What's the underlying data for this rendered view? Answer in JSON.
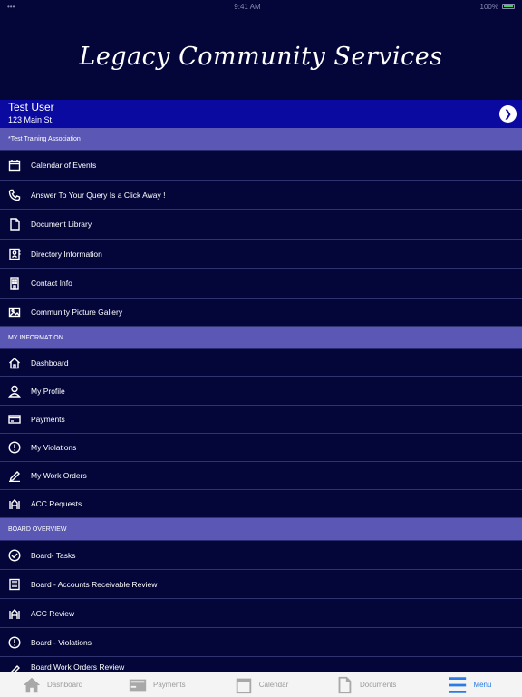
{
  "status_bar": {
    "time": "9:41 AM",
    "battery": "100%"
  },
  "brand": {
    "title": "Legacy Community Services"
  },
  "user": {
    "name": "Test User",
    "address": "123 Main St.",
    "go_icon": "chevron-right-icon"
  },
  "menu": {
    "association_header": "*Test Training Association",
    "association_items": [
      {
        "label": "Calendar of Events",
        "icon": "calendar-icon"
      },
      {
        "label": "Answer To Your Query Is a Click Away !",
        "icon": "phone-icon"
      },
      {
        "label": "Document Library",
        "icon": "document-icon"
      },
      {
        "label": "Directory Information",
        "icon": "contact-card-icon"
      },
      {
        "label": "Contact Info",
        "icon": "building-icon"
      },
      {
        "label": "Community Picture Gallery",
        "icon": "image-icon"
      }
    ],
    "my_info_header": "MY INFORMATION",
    "my_info_items": [
      {
        "label": "Dashboard",
        "icon": "home-icon"
      },
      {
        "label": "My Profile",
        "icon": "person-icon"
      },
      {
        "label": "Payments",
        "icon": "card-icon"
      },
      {
        "label": "My Violations",
        "icon": "alert-icon"
      },
      {
        "label": "My Work Orders",
        "icon": "pen-icon"
      },
      {
        "label": "ACC Requests",
        "icon": "acc-icon"
      }
    ],
    "board_header": "BOARD OVERVIEW",
    "board_items": [
      {
        "label": "Board- Tasks",
        "icon": "check-circle-icon"
      },
      {
        "label": "Board - Accounts Receivable Review",
        "icon": "ledger-icon"
      },
      {
        "label": "ACC Review",
        "icon": "acc-icon"
      },
      {
        "label": "Board - Violations",
        "icon": "alert-icon"
      },
      {
        "label": "Board Work Orders Review",
        "icon": "pen-icon"
      }
    ]
  },
  "tabs": [
    {
      "label": "Dashboard",
      "icon": "home-icon"
    },
    {
      "label": "Payments",
      "icon": "card-icon"
    },
    {
      "label": "Calendar",
      "icon": "calendar-icon"
    },
    {
      "label": "Documents",
      "icon": "document-icon"
    },
    {
      "label": "Menu",
      "icon": "menu-icon",
      "active": true
    }
  ],
  "colors": {
    "background": "#04063a",
    "user_card": "#0a0aa0",
    "section": "#5b58b5",
    "accent": "#2a7be4"
  }
}
